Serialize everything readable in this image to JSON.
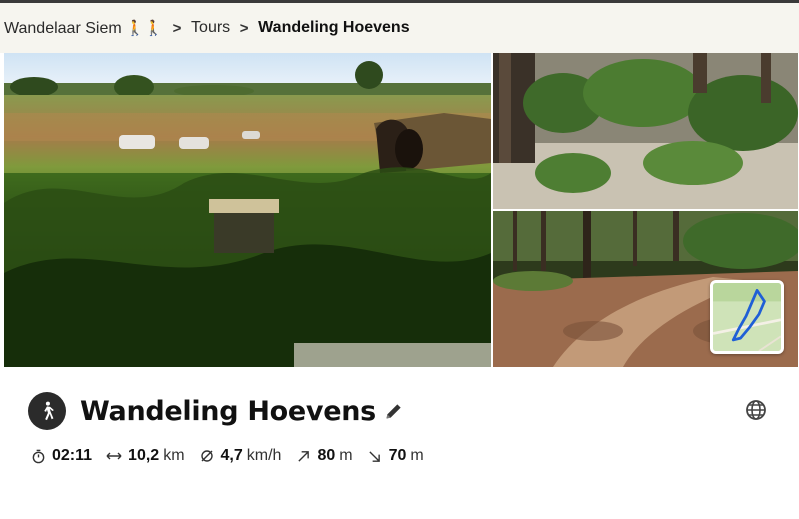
{
  "breadcrumb": {
    "user": "Wandelaar Siem",
    "user_badges": "🚶🚶",
    "section": "Tours",
    "current": "Wandeling Hoevens",
    "separator": ">"
  },
  "tour": {
    "title": "Wandeling Hoevens",
    "sport_icon": "walking-person-icon",
    "stats": [
      {
        "icon": "stopwatch-icon",
        "value": "02:11",
        "unit": ""
      },
      {
        "icon": "horizontal-arrows-icon",
        "value": "10,2",
        "unit": "km"
      },
      {
        "icon": "average-speed-icon",
        "value": "4,7",
        "unit": "km/h"
      },
      {
        "icon": "uphill-arrow-icon",
        "value": "80",
        "unit": "m"
      },
      {
        "icon": "downhill-arrow-icon",
        "value": "70",
        "unit": "m"
      }
    ]
  },
  "icons": {
    "edit": "pencil-icon",
    "language": "globe-icon",
    "map": "route-map-thumbnail"
  },
  "colors": {
    "breadcrumb_bg": "#f6f5ef",
    "route_line": "#1f5fd6",
    "icon_dark": "#2b2b2b"
  }
}
